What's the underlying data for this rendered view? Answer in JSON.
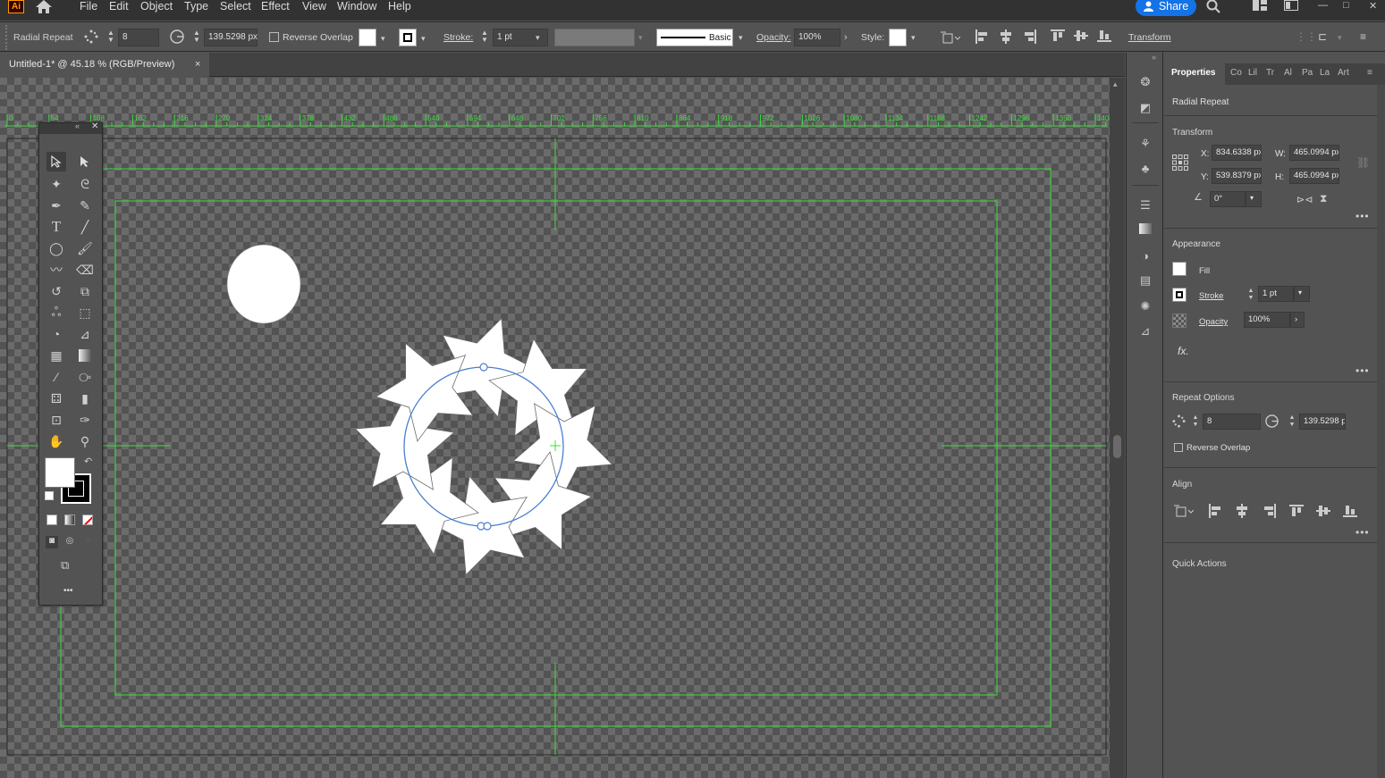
{
  "app": {
    "logo": "Ai"
  },
  "menu": [
    "File",
    "Edit",
    "Object",
    "Type",
    "Select",
    "Effect",
    "View",
    "Window",
    "Help"
  ],
  "share_label": "Share",
  "controlbar": {
    "object_type": "Radial Repeat",
    "instances": "8",
    "radius": "139.5298 px",
    "reverse_overlap": "Reverse Overlap",
    "stroke_label": "Stroke:",
    "stroke_value": "1 pt",
    "brush_label": "Basic",
    "opacity_label": "Opacity:",
    "opacity_value": "100%",
    "style_label": "Style:",
    "transform_label": "Transform"
  },
  "document": {
    "tab_title": "Untitled-1* @ 45.18 % (RGB/Preview)",
    "close": "×"
  },
  "ruler": {
    "ticks": [
      "0",
      "54",
      "108",
      "162",
      "216",
      "270",
      "324",
      "378",
      "432",
      "486",
      "540",
      "594",
      "648",
      "702",
      "756",
      "810",
      "864",
      "918",
      "972",
      "1026",
      "1080",
      "1134",
      "1188",
      "1242",
      "1296",
      "1350",
      "1404"
    ]
  },
  "toolbox_more": "•••",
  "properties": {
    "tabs": [
      "Properties",
      "Co",
      "Lil",
      "Tr",
      "Al",
      "Pa",
      "La",
      "Art"
    ],
    "object_type": "Radial Repeat",
    "transform": {
      "title": "Transform",
      "x_label": "X:",
      "x": "834.6338 px",
      "y_label": "Y:",
      "y": "539.8379 px",
      "w_label": "W:",
      "w": "465.0994 px",
      "h_label": "H:",
      "h": "465.0994 px",
      "angle": "0°"
    },
    "appearance": {
      "title": "Appearance",
      "fill": "Fill",
      "stroke": "Stroke",
      "stroke_value": "1 pt",
      "opacity": "Opacity",
      "opacity_value": "100%",
      "fx": "fx."
    },
    "repeat_options": {
      "title": "Repeat Options",
      "instances": "8",
      "radius": "139.5298 p",
      "reverse_overlap": "Reverse Overlap"
    },
    "align": {
      "title": "Align"
    },
    "quick_actions": {
      "title": "Quick Actions"
    },
    "more": "•••"
  },
  "colors": {
    "guide": "#3ddc3d",
    "selection": "#4a7fd0",
    "accent": "#1473e6"
  }
}
